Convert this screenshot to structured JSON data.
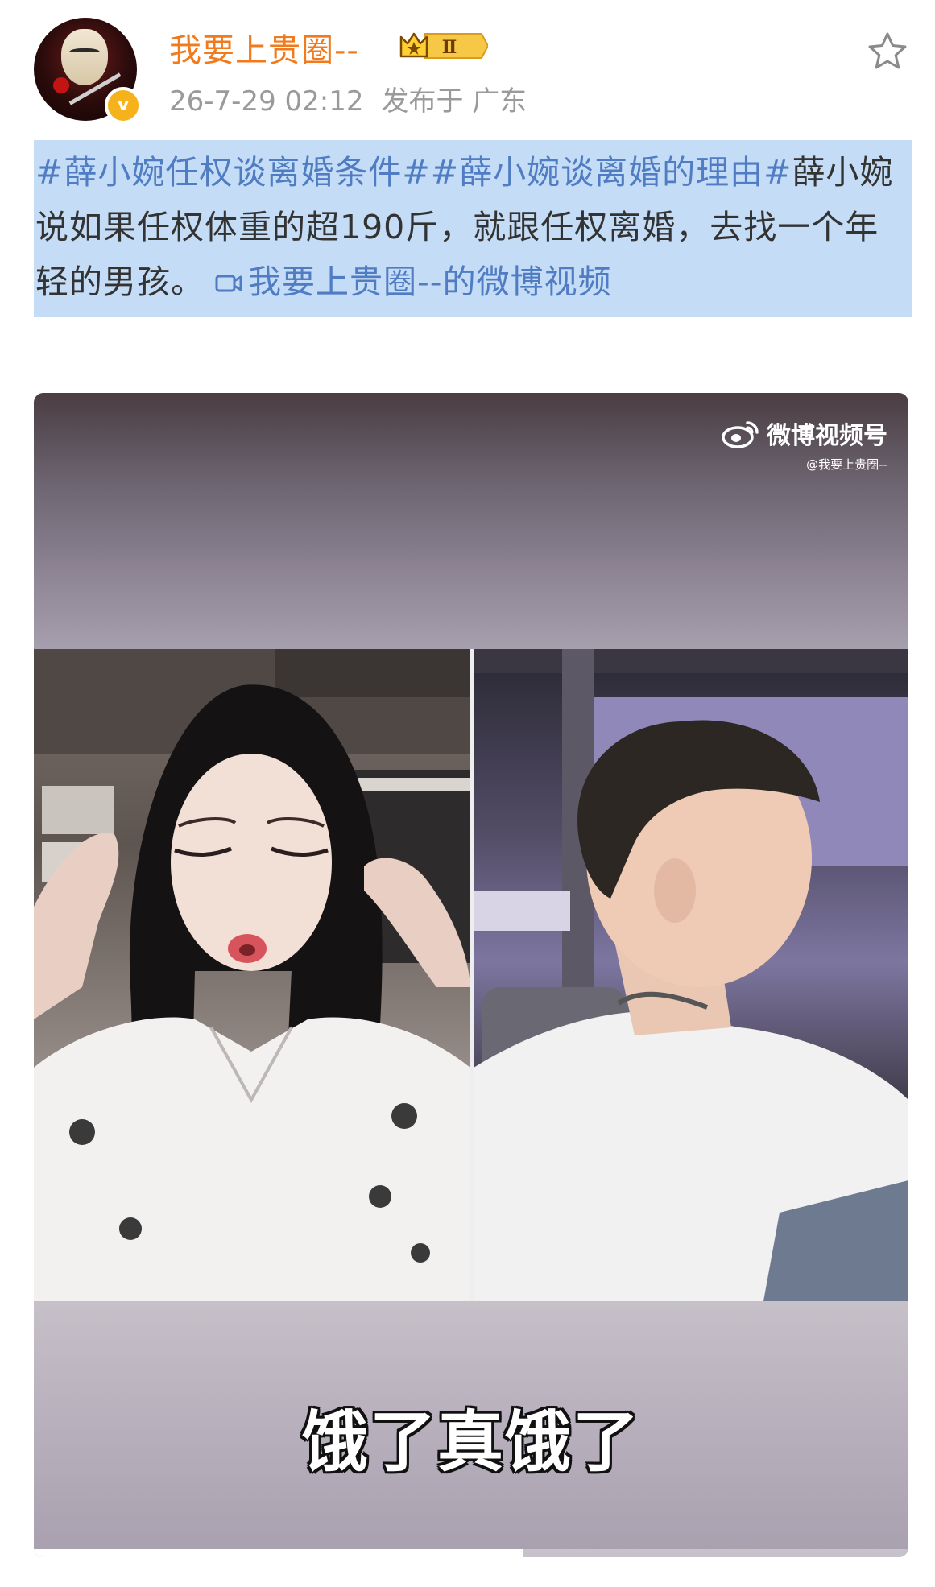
{
  "post": {
    "username": "我要上贵圈--",
    "level": "Ⅱ",
    "verified_mark": "v",
    "timestamp": "26-7-29 02:12",
    "location": "发布于 广东",
    "hashtag1": "#薛小婉任权谈离婚条件#",
    "hashtag2": "#薛小婉谈离婚的理由#",
    "body": "薛小婉说如果任权体重的超190斤，就跟任权离婚，去找一个年轻的男孩。",
    "video_link": "我要上贵圈--的微博视频"
  },
  "video": {
    "watermark_title": "微博视频号",
    "watermark_handle": "@我要上贵圈--",
    "subtitle": "饿了真饿了",
    "progress": 0.56
  },
  "colors": {
    "username": "#f07a1c",
    "link": "#4f7cc2",
    "selection": "#c4dcf5",
    "badge": "#f6b21b"
  },
  "icons": [
    "star-icon",
    "video-icon",
    "weibo-logo-icon",
    "verified-icon",
    "crown-icon"
  ]
}
